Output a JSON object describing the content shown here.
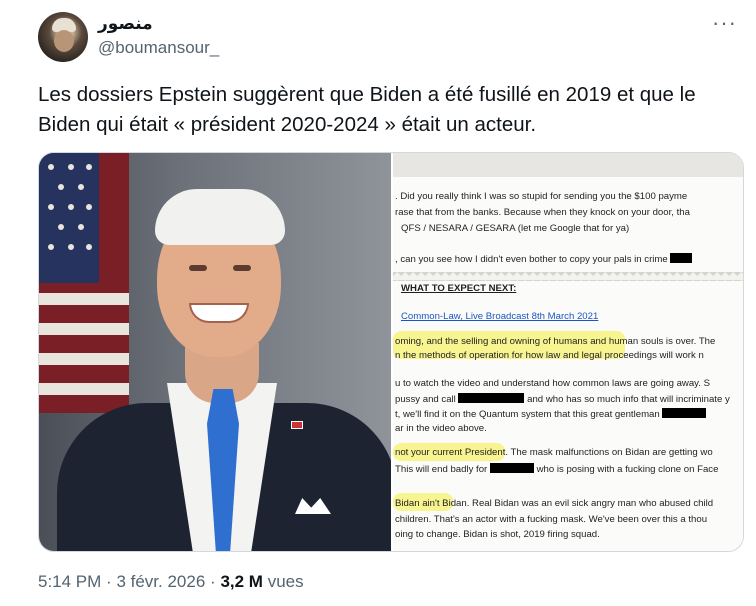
{
  "author": {
    "display_name": "منصور",
    "handle": "@boumansour_"
  },
  "tweet": {
    "text_line1": "Les dossiers Epstein suggèrent que Biden a été fusillé en 2019 et que le",
    "text_line2": "Biden qui était « président 2020-2024 » était un acteur."
  },
  "menu": {
    "more_label": "···"
  },
  "media": {
    "document_lines": [
      ". Did you really think I was so stupid for sending you the $100 payme",
      "rase that from the banks. Because when they knock on your door, tha",
      "QFS / NESARA / GESARA (let me Google that for ya)",
      ", can you see how I didn't even bother to copy your pals in crime",
      "WHAT TO EXPECT NEXT:",
      "Common-Law, Live Broadcast 8th March 2021",
      "oming, and the selling and owning of humans and human souls is over. The",
      "n the methods of operation for how law and legal proceedings will work n",
      "u to watch the video and understand how common laws are going away. S",
      "pussy and call",
      "and who has so much info that will incriminate y",
      "t, we'll find it on the Quantum system that this great gentleman",
      "ar in the video above.",
      "not your current President. The mask malfunctions on Bidan are getting wo",
      "This will end badly for",
      "who is posing with a fucking clone on Face",
      "Bidan ain't Bidan. Real Bidan was an evil sick angry man who abused child",
      "children. That's an actor with a fucking mask. We've been over this a thou",
      "oing to change. Bidan is shot, 2019 firing squad."
    ]
  },
  "footer": {
    "time": "5:14 PM",
    "separator": "·",
    "date": "3 févr. 2026",
    "views_count": "3,2 M",
    "views_label": "vues"
  },
  "colors": {
    "text_primary": "#0f1419",
    "text_secondary": "#536471",
    "link": "#1a55c7",
    "highlight": "#f5f03c"
  }
}
